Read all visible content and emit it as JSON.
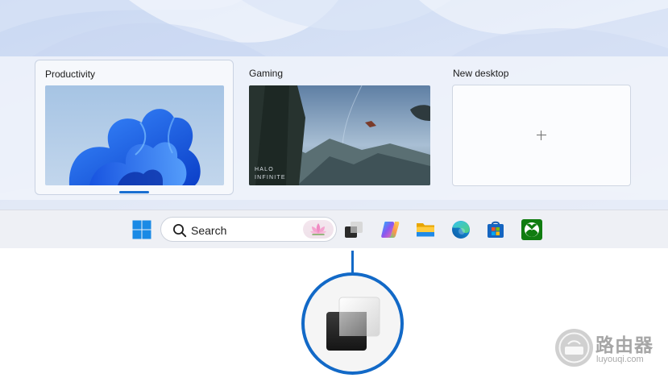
{
  "task_view": {
    "desktops": [
      {
        "label": "Productivity",
        "active": true,
        "thumbnail": "windows-bloom-wallpaper"
      },
      {
        "label": "Gaming",
        "active": false,
        "thumbnail": "halo-infinite-screenshot",
        "thumbnail_text": "HALO INFINITE"
      },
      {
        "label": "New desktop",
        "active": false,
        "thumbnail": "plus-icon"
      }
    ]
  },
  "taskbar": {
    "search": {
      "label": "Search",
      "highlight_icon": "lotus-icon"
    },
    "items": [
      "windows-start-icon",
      "task-view-icon",
      "copilot-icon",
      "file-explorer-icon",
      "edge-icon",
      "microsoft-store-icon",
      "xbox-icon"
    ]
  },
  "callout": {
    "icon": "task-view-icon",
    "accent": "#1269c7"
  },
  "watermark": {
    "text": "路由器",
    "domain": "luyouqi.com"
  },
  "colors": {
    "accent": "#1a6fd1",
    "taskbar": "#eef0f5"
  }
}
